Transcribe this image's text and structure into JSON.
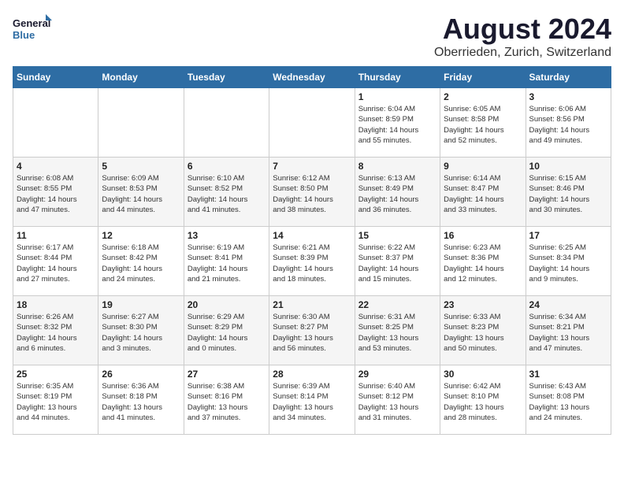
{
  "logo": {
    "line1": "General",
    "line2": "Blue"
  },
  "title": "August 2024",
  "subtitle": "Oberrieden, Zurich, Switzerland",
  "headers": [
    "Sunday",
    "Monday",
    "Tuesday",
    "Wednesday",
    "Thursday",
    "Friday",
    "Saturday"
  ],
  "weeks": [
    [
      {
        "day": "",
        "info": ""
      },
      {
        "day": "",
        "info": ""
      },
      {
        "day": "",
        "info": ""
      },
      {
        "day": "",
        "info": ""
      },
      {
        "day": "1",
        "info": "Sunrise: 6:04 AM\nSunset: 8:59 PM\nDaylight: 14 hours\nand 55 minutes."
      },
      {
        "day": "2",
        "info": "Sunrise: 6:05 AM\nSunset: 8:58 PM\nDaylight: 14 hours\nand 52 minutes."
      },
      {
        "day": "3",
        "info": "Sunrise: 6:06 AM\nSunset: 8:56 PM\nDaylight: 14 hours\nand 49 minutes."
      }
    ],
    [
      {
        "day": "4",
        "info": "Sunrise: 6:08 AM\nSunset: 8:55 PM\nDaylight: 14 hours\nand 47 minutes."
      },
      {
        "day": "5",
        "info": "Sunrise: 6:09 AM\nSunset: 8:53 PM\nDaylight: 14 hours\nand 44 minutes."
      },
      {
        "day": "6",
        "info": "Sunrise: 6:10 AM\nSunset: 8:52 PM\nDaylight: 14 hours\nand 41 minutes."
      },
      {
        "day": "7",
        "info": "Sunrise: 6:12 AM\nSunset: 8:50 PM\nDaylight: 14 hours\nand 38 minutes."
      },
      {
        "day": "8",
        "info": "Sunrise: 6:13 AM\nSunset: 8:49 PM\nDaylight: 14 hours\nand 36 minutes."
      },
      {
        "day": "9",
        "info": "Sunrise: 6:14 AM\nSunset: 8:47 PM\nDaylight: 14 hours\nand 33 minutes."
      },
      {
        "day": "10",
        "info": "Sunrise: 6:15 AM\nSunset: 8:46 PM\nDaylight: 14 hours\nand 30 minutes."
      }
    ],
    [
      {
        "day": "11",
        "info": "Sunrise: 6:17 AM\nSunset: 8:44 PM\nDaylight: 14 hours\nand 27 minutes."
      },
      {
        "day": "12",
        "info": "Sunrise: 6:18 AM\nSunset: 8:42 PM\nDaylight: 14 hours\nand 24 minutes."
      },
      {
        "day": "13",
        "info": "Sunrise: 6:19 AM\nSunset: 8:41 PM\nDaylight: 14 hours\nand 21 minutes."
      },
      {
        "day": "14",
        "info": "Sunrise: 6:21 AM\nSunset: 8:39 PM\nDaylight: 14 hours\nand 18 minutes."
      },
      {
        "day": "15",
        "info": "Sunrise: 6:22 AM\nSunset: 8:37 PM\nDaylight: 14 hours\nand 15 minutes."
      },
      {
        "day": "16",
        "info": "Sunrise: 6:23 AM\nSunset: 8:36 PM\nDaylight: 14 hours\nand 12 minutes."
      },
      {
        "day": "17",
        "info": "Sunrise: 6:25 AM\nSunset: 8:34 PM\nDaylight: 14 hours\nand 9 minutes."
      }
    ],
    [
      {
        "day": "18",
        "info": "Sunrise: 6:26 AM\nSunset: 8:32 PM\nDaylight: 14 hours\nand 6 minutes."
      },
      {
        "day": "19",
        "info": "Sunrise: 6:27 AM\nSunset: 8:30 PM\nDaylight: 14 hours\nand 3 minutes."
      },
      {
        "day": "20",
        "info": "Sunrise: 6:29 AM\nSunset: 8:29 PM\nDaylight: 14 hours\nand 0 minutes."
      },
      {
        "day": "21",
        "info": "Sunrise: 6:30 AM\nSunset: 8:27 PM\nDaylight: 13 hours\nand 56 minutes."
      },
      {
        "day": "22",
        "info": "Sunrise: 6:31 AM\nSunset: 8:25 PM\nDaylight: 13 hours\nand 53 minutes."
      },
      {
        "day": "23",
        "info": "Sunrise: 6:33 AM\nSunset: 8:23 PM\nDaylight: 13 hours\nand 50 minutes."
      },
      {
        "day": "24",
        "info": "Sunrise: 6:34 AM\nSunset: 8:21 PM\nDaylight: 13 hours\nand 47 minutes."
      }
    ],
    [
      {
        "day": "25",
        "info": "Sunrise: 6:35 AM\nSunset: 8:19 PM\nDaylight: 13 hours\nand 44 minutes."
      },
      {
        "day": "26",
        "info": "Sunrise: 6:36 AM\nSunset: 8:18 PM\nDaylight: 13 hours\nand 41 minutes."
      },
      {
        "day": "27",
        "info": "Sunrise: 6:38 AM\nSunset: 8:16 PM\nDaylight: 13 hours\nand 37 minutes."
      },
      {
        "day": "28",
        "info": "Sunrise: 6:39 AM\nSunset: 8:14 PM\nDaylight: 13 hours\nand 34 minutes."
      },
      {
        "day": "29",
        "info": "Sunrise: 6:40 AM\nSunset: 8:12 PM\nDaylight: 13 hours\nand 31 minutes."
      },
      {
        "day": "30",
        "info": "Sunrise: 6:42 AM\nSunset: 8:10 PM\nDaylight: 13 hours\nand 28 minutes."
      },
      {
        "day": "31",
        "info": "Sunrise: 6:43 AM\nSunset: 8:08 PM\nDaylight: 13 hours\nand 24 minutes."
      }
    ]
  ]
}
